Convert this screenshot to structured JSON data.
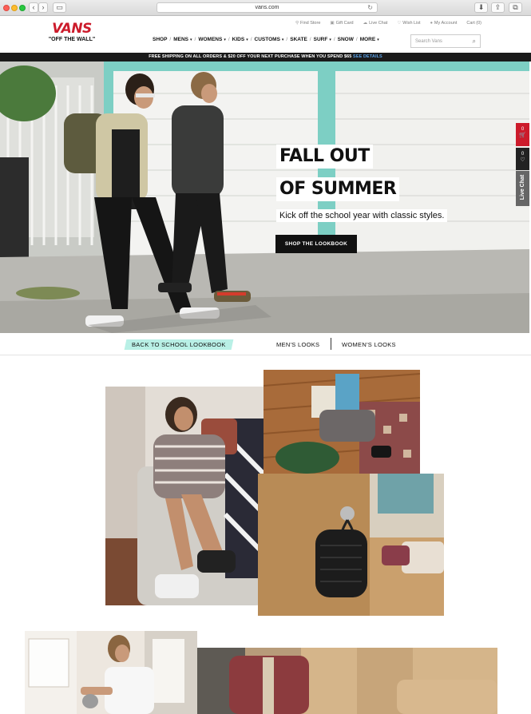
{
  "browser": {
    "url": "vans.com",
    "back_glyph": "‹",
    "forward_glyph": "›",
    "reload_glyph": "↻",
    "sidebar_glyph": "▭",
    "download_glyph": "⬇",
    "share_glyph": "⇪",
    "tabs_glyph": "⧉"
  },
  "utility_nav": [
    {
      "icon": "map-pin-icon",
      "glyph": "⚲",
      "label": "Find Store"
    },
    {
      "icon": "gift-icon",
      "glyph": "▣",
      "label": "Gift Card"
    },
    {
      "icon": "chat-icon",
      "glyph": "☁",
      "label": "Live Chat"
    },
    {
      "icon": "heart-icon",
      "glyph": "♡",
      "label": "Wish List"
    },
    {
      "icon": "user-icon",
      "glyph": "👤",
      "label": "My Account"
    },
    {
      "icon": "cart-icon",
      "glyph": "",
      "label": "Cart (0)"
    }
  ],
  "logo": {
    "word": "VANS",
    "tagline": "\"OFF THE WALL\"",
    "brand_color": "#cc1b2b"
  },
  "main_nav": [
    {
      "label": "SHOP",
      "dropdown": false
    },
    {
      "label": "MENS",
      "dropdown": true
    },
    {
      "label": "WOMENS",
      "dropdown": true
    },
    {
      "label": "KIDS",
      "dropdown": true
    },
    {
      "label": "CUSTOMS",
      "dropdown": true
    },
    {
      "label": "SKATE",
      "dropdown": false
    },
    {
      "label": "SURF",
      "dropdown": true
    },
    {
      "label": "SNOW",
      "dropdown": false
    },
    {
      "label": "MORE",
      "dropdown": true
    }
  ],
  "search": {
    "placeholder": "Search Vans",
    "icon": "search-icon"
  },
  "promo": {
    "text": "FREE SHIPPING ON ALL ORDERS & $20 OFF YOUR NEXT PURCHASE WHEN YOU SPEND $65 ",
    "link": "SEE DETAILS"
  },
  "hero": {
    "headline_line1": "FALL OUT",
    "headline_line2": "OF SUMMER",
    "subhead": "Kick off the school year with classic styles.",
    "cta": "SHOP THE LOOKBOOK"
  },
  "side_tabs": {
    "cart_count": "0",
    "wish_count": "0",
    "chat_label": "Live Chat",
    "cart_glyph": "🛒",
    "wish_glyph": "♡"
  },
  "subnav": [
    {
      "label": "BACK TO SCHOOL LOOKBOOK",
      "active": true
    },
    {
      "label": "MEN'S LOOKS",
      "active": false
    },
    {
      "label": "WOMEN'S LOOKS",
      "active": false
    }
  ]
}
